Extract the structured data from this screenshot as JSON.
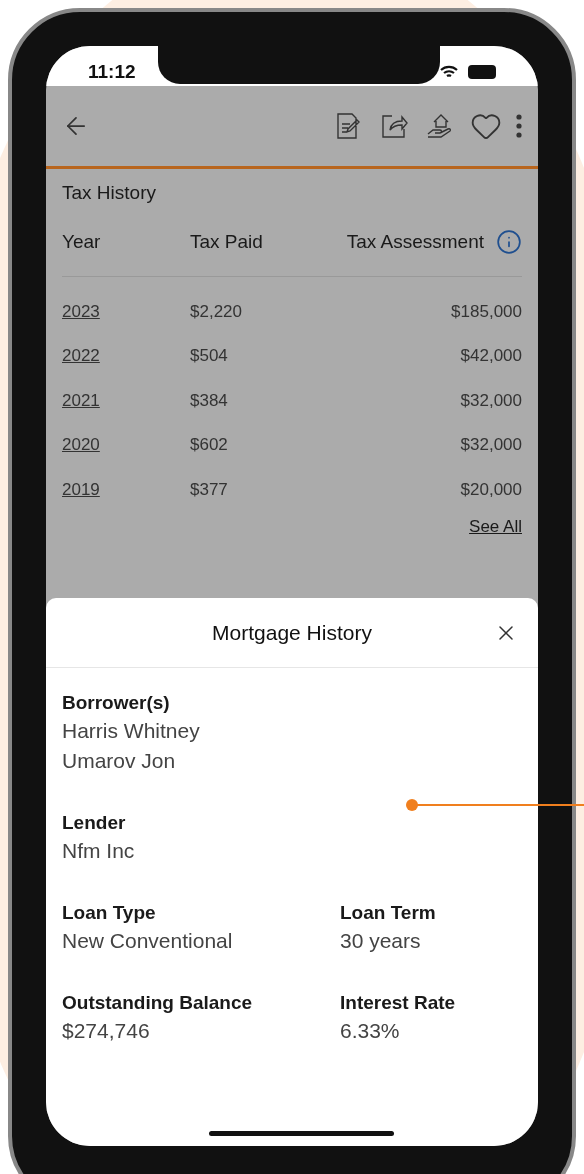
{
  "status_bar": {
    "time": "11:12"
  },
  "tax_history": {
    "title": "Tax History",
    "columns": [
      "Year",
      "Tax Paid",
      "Tax Assessment"
    ],
    "rows": [
      {
        "year": "2023",
        "tax_paid": "$2,220",
        "tax_assessment": "$185,000"
      },
      {
        "year": "2022",
        "tax_paid": "$504",
        "tax_assessment": "$42,000"
      },
      {
        "year": "2021",
        "tax_paid": "$384",
        "tax_assessment": "$32,000"
      },
      {
        "year": "2020",
        "tax_paid": "$602",
        "tax_assessment": "$32,000"
      },
      {
        "year": "2019",
        "tax_paid": "$377",
        "tax_assessment": "$20,000"
      }
    ],
    "see_all": "See All"
  },
  "sheet": {
    "title": "Mortgage History",
    "rows": [
      {
        "fields": [
          {
            "label": "Borrower(s)",
            "values": [
              "Harris Whitney",
              "Umarov Jon"
            ]
          }
        ]
      },
      {
        "fields": [
          {
            "label": "Lender",
            "values": [
              "Nfm Inc"
            ]
          }
        ]
      },
      {
        "fields": [
          {
            "label": "Loan Type",
            "values": [
              "New Conventional"
            ]
          },
          {
            "label": "Loan Term",
            "values": [
              "30 years"
            ]
          }
        ]
      },
      {
        "fields": [
          {
            "label": "Outstanding Balance",
            "values": [
              "$274,746"
            ]
          },
          {
            "label": "Interest Rate",
            "values": [
              "6.33%"
            ]
          }
        ]
      }
    ]
  }
}
